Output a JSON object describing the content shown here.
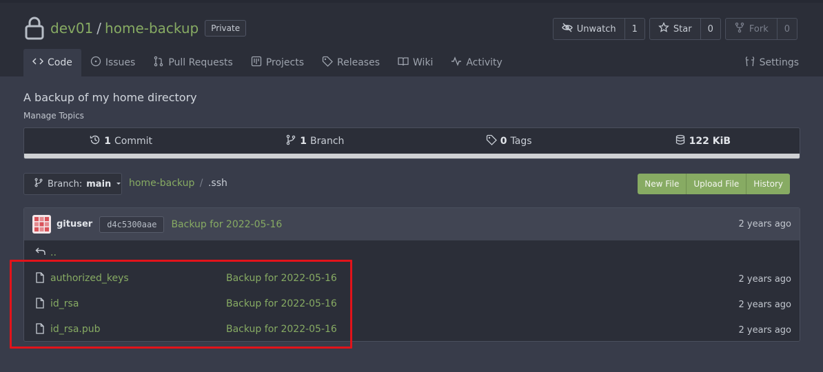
{
  "repo": {
    "owner": "dev01",
    "separator": "/",
    "name": "home-backup",
    "visibility": "Private",
    "description": "A backup of my home directory",
    "manage_topics": "Manage Topics"
  },
  "actions": {
    "watch": {
      "label": "Unwatch",
      "count": "1"
    },
    "star": {
      "label": "Star",
      "count": "0"
    },
    "fork": {
      "label": "Fork",
      "count": "0"
    }
  },
  "tabs": [
    {
      "label": "Code",
      "icon": "code-icon",
      "active": true
    },
    {
      "label": "Issues",
      "icon": "issue-icon"
    },
    {
      "label": "Pull Requests",
      "icon": "pull-request-icon"
    },
    {
      "label": "Projects",
      "icon": "project-icon"
    },
    {
      "label": "Releases",
      "icon": "tag-icon"
    },
    {
      "label": "Wiki",
      "icon": "book-icon"
    },
    {
      "label": "Activity",
      "icon": "pulse-icon"
    }
  ],
  "settings_label": "Settings",
  "stats": {
    "commits": {
      "count": "1",
      "label": "Commit"
    },
    "branches": {
      "count": "1",
      "label": "Branch"
    },
    "tags": {
      "count": "0",
      "label": "Tags"
    },
    "size": {
      "value": "122 KiB"
    }
  },
  "branch": {
    "prefix": "Branch:",
    "name": "main"
  },
  "path": {
    "repo": "home-backup",
    "separator": "/",
    "dir": ".ssh"
  },
  "file_actions": {
    "new_file": "New File",
    "upload_file": "Upload File",
    "history": "History"
  },
  "latest_commit": {
    "author": "gituser",
    "sha": "d4c5300aae",
    "message": "Backup for 2022-05-16",
    "time": "2 years ago"
  },
  "parent_dir": "..",
  "files": [
    {
      "name": "authorized_keys",
      "message": "Backup for 2022-05-16",
      "time": "2 years ago"
    },
    {
      "name": "id_rsa",
      "message": "Backup for 2022-05-16",
      "time": "2 years ago"
    },
    {
      "name": "id_rsa.pub",
      "message": "Backup for 2022-05-16",
      "time": "2 years ago"
    }
  ],
  "colors": {
    "accent": "#87ab63",
    "highlight": "#e2131a"
  }
}
